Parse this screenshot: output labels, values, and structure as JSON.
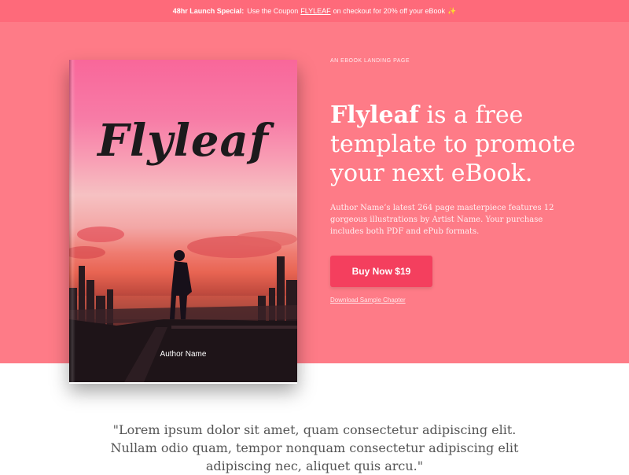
{
  "announcement": {
    "strong": "48hr Launch Special:",
    "text": "Use the Coupon",
    "coupon": "FLYLEAF",
    "text_after": "on checkout for 20% off your eBook",
    "icon": "sparkle-icon"
  },
  "book": {
    "title": "Flyleaf",
    "author": "Author Name"
  },
  "hero": {
    "kicker": "AN EBOOK LANDING PAGE",
    "headline_bold": "Flyleaf",
    "headline_rest": " is a free template to promote your next eBook.",
    "description": "Author Name’s latest 264 page masterpiece features 12 gorgeous illustrations by Artist Name. Your purchase includes both PDF and ePub formats.",
    "buy_label": "Buy Now $19",
    "sample_link": "Download Sample Chapter"
  },
  "quote": {
    "text": "\"Lorem ipsum dolor sit amet, quam consectetur adipiscing elit. Nullam odio quam, tempor nonquam consectetur adipiscing elit adipiscing nec, aliquet quis arcu.\""
  },
  "colors": {
    "announcement_bg": "#fe6a7a",
    "hero_bg": "#fe7b87",
    "button_bg": "#f43f5e"
  }
}
